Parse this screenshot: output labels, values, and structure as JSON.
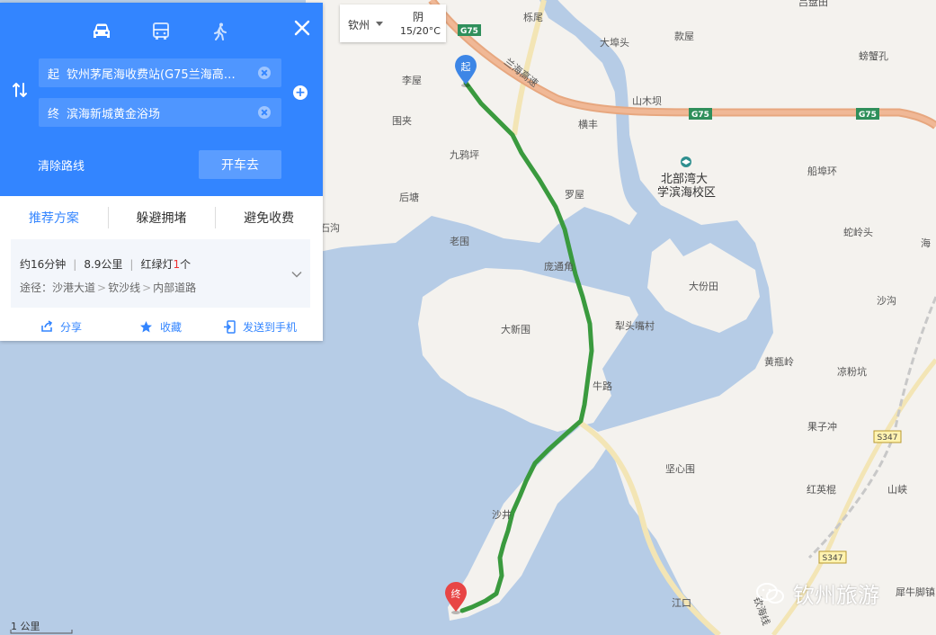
{
  "panel": {
    "modes": [
      {
        "name": "drive",
        "icon": "car-icon"
      },
      {
        "name": "bus",
        "icon": "bus-icon"
      },
      {
        "name": "walk",
        "icon": "walk-icon"
      }
    ],
    "start_tag": "起",
    "start_text": "钦州茅尾海收费站(G75兰海高…",
    "end_tag": "终",
    "end_text": "滨海新城黄金浴场",
    "clear_route": "清除路线",
    "go_button": "开车去",
    "tabs": [
      "推荐方案",
      "躲避拥堵",
      "避免收费"
    ],
    "plan": {
      "duration": "约16分钟",
      "distance": "8.9公里",
      "lights_prefix": "红绿灯",
      "lights_count": "1",
      "lights_unit": "个",
      "via_label": "途径：",
      "via": [
        "沙港大道",
        "钦沙线",
        "内部道路"
      ]
    },
    "actions": {
      "share": "分享",
      "favorite": "收藏",
      "send": "发送到手机"
    },
    "accent_color": "#3385ff"
  },
  "weather": {
    "city": "钦州",
    "condition": "阴",
    "temperature": "15/20°C"
  },
  "map": {
    "start_marker": "起",
    "end_marker": "终",
    "shields": [
      "G75",
      "G75",
      "G75",
      "S347",
      "S347"
    ],
    "highway_label": "兰海高速",
    "labels": [
      "吕盘田",
      "栎尾",
      "大埠头",
      "款屋",
      "螃蟹孔",
      "李屋",
      "山木坝",
      "横丰",
      "围夹",
      "九鸦坪",
      "北部湾大",
      "学滨海校区",
      "船埠环",
      "后塘",
      "罗屋",
      "石沟",
      "老围",
      "蛇岭头",
      "海",
      "庞通角",
      "大份田",
      "沙沟",
      "大新围",
      "犁头嘴村",
      "黄瓶岭",
      "凉粉坑",
      "牛路",
      "果子冲",
      "坚心围",
      "红英棍",
      "山峡",
      "沙井",
      "江口",
      "犀牛脚镇",
      "钦海线"
    ],
    "scale": "1 公里",
    "route_color": "#3a9a3e"
  },
  "watermark": "钦州旅游"
}
